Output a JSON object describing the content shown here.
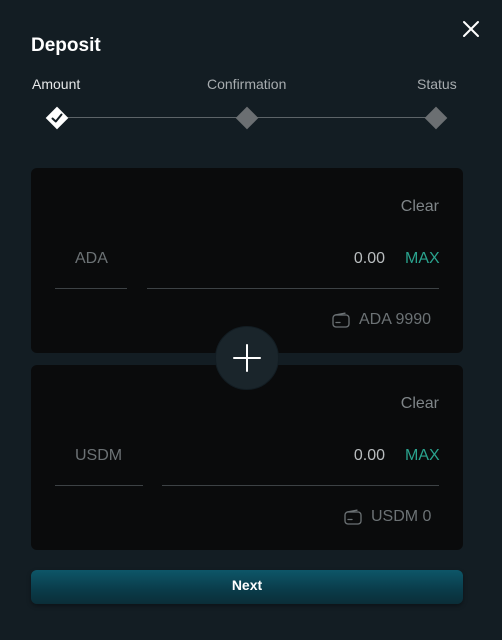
{
  "dialog": {
    "title": "Deposit",
    "close_icon": "close-icon"
  },
  "steps": [
    {
      "label": "Amount",
      "state": "completed"
    },
    {
      "label": "Confirmation",
      "state": "pending"
    },
    {
      "label": "Status",
      "state": "pending"
    }
  ],
  "inputs": [
    {
      "clear_label": "Clear",
      "token": "ADA",
      "amount": "0.00",
      "max_label": "MAX",
      "balance": "ADA 9990",
      "balance_icon": "wallet-icon"
    },
    {
      "clear_label": "Clear",
      "token": "USDM",
      "amount": "0.00",
      "max_label": "MAX",
      "balance": "USDM 0",
      "balance_icon": "wallet-icon"
    }
  ],
  "plus_icon": "plus-icon",
  "next_label": "Next",
  "colors": {
    "background": "#131d23",
    "card": "#0a0b0c",
    "accent": "#2aa38e",
    "button": "#0d5668"
  }
}
